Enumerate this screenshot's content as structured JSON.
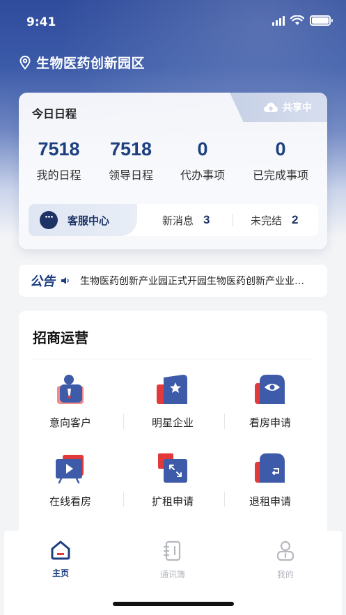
{
  "status": {
    "time": "9:41"
  },
  "location": {
    "name": "生物医药创新园区"
  },
  "schedule": {
    "title": "今日日程",
    "share_label": "共享中",
    "stats": [
      {
        "value": "7518",
        "label": "我的日程"
      },
      {
        "value": "7518",
        "label": "领导日程"
      },
      {
        "value": "0",
        "label": "代办事项"
      },
      {
        "value": "0",
        "label": "已完成事项"
      }
    ],
    "service": {
      "label": "客服中心",
      "new_msg_label": "新消息",
      "new_msg_count": "3",
      "pending_label": "未完结",
      "pending_count": "2"
    }
  },
  "notice": {
    "label": "公告",
    "text": "生物医药创新产业园正式开园生物医药创新产业业…"
  },
  "investment": {
    "title": "招商运营",
    "items": [
      {
        "label": "意向客户",
        "icon": "customer-icon"
      },
      {
        "label": "明星企业",
        "icon": "star-enterprise-icon"
      },
      {
        "label": "看房申请",
        "icon": "view-house-icon"
      },
      {
        "label": "在线看房",
        "icon": "online-view-icon"
      },
      {
        "label": "扩租申请",
        "icon": "expand-rent-icon"
      },
      {
        "label": "退租申请",
        "icon": "return-rent-icon"
      }
    ]
  },
  "tabbar": {
    "tabs": [
      {
        "label": "主页",
        "active": true
      },
      {
        "label": "通讯簿",
        "active": false
      },
      {
        "label": "我的",
        "active": false
      }
    ]
  },
  "colors": {
    "primary": "#1d3f80",
    "accent_red": "#e23a3a",
    "tab_inactive": "#b5b8bf"
  }
}
